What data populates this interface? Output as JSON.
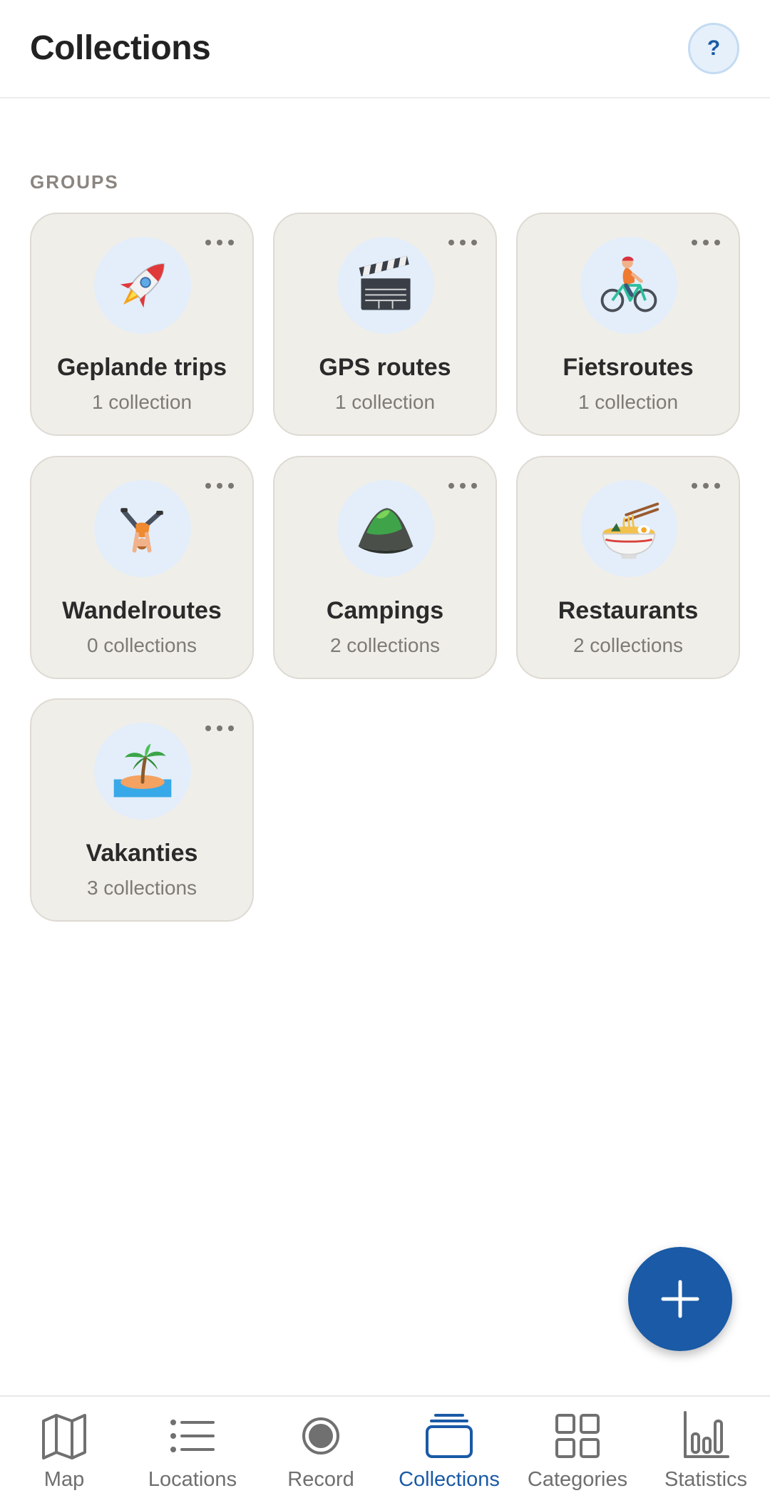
{
  "header": {
    "title": "Collections",
    "help_label": "?"
  },
  "section": {
    "label": "GROUPS"
  },
  "groups": [
    {
      "name": "Geplande trips",
      "count": "1 collection",
      "icon": "rocket-icon"
    },
    {
      "name": "GPS routes",
      "count": "1 collection",
      "icon": "clapper-board-icon"
    },
    {
      "name": "Fietsroutes",
      "count": "1 collection",
      "icon": "cyclist-icon"
    },
    {
      "name": "Wandelroutes",
      "count": "0 collections",
      "icon": "cartwheel-person-icon"
    },
    {
      "name": "Campings",
      "count": "2 collections",
      "icon": "mountain-icon"
    },
    {
      "name": "Restaurants",
      "count": "2 collections",
      "icon": "noodle-bowl-icon"
    },
    {
      "name": "Vakanties",
      "count": "3 collections",
      "icon": "desert-island-icon"
    }
  ],
  "nav": {
    "items": [
      {
        "label": "Map",
        "icon": "map-icon"
      },
      {
        "label": "Locations",
        "icon": "list-icon"
      },
      {
        "label": "Record",
        "icon": "record-icon"
      },
      {
        "label": "Collections",
        "icon": "collections-icon"
      },
      {
        "label": "Categories",
        "icon": "grid-icon"
      },
      {
        "label": "Statistics",
        "icon": "bar-chart-icon"
      }
    ],
    "active": "Collections"
  },
  "colors": {
    "accent": "#1a5aa6",
    "card_bg": "#f0eee9",
    "icon_circle": "#e3eefa",
    "muted_text": "#7e7a75"
  }
}
